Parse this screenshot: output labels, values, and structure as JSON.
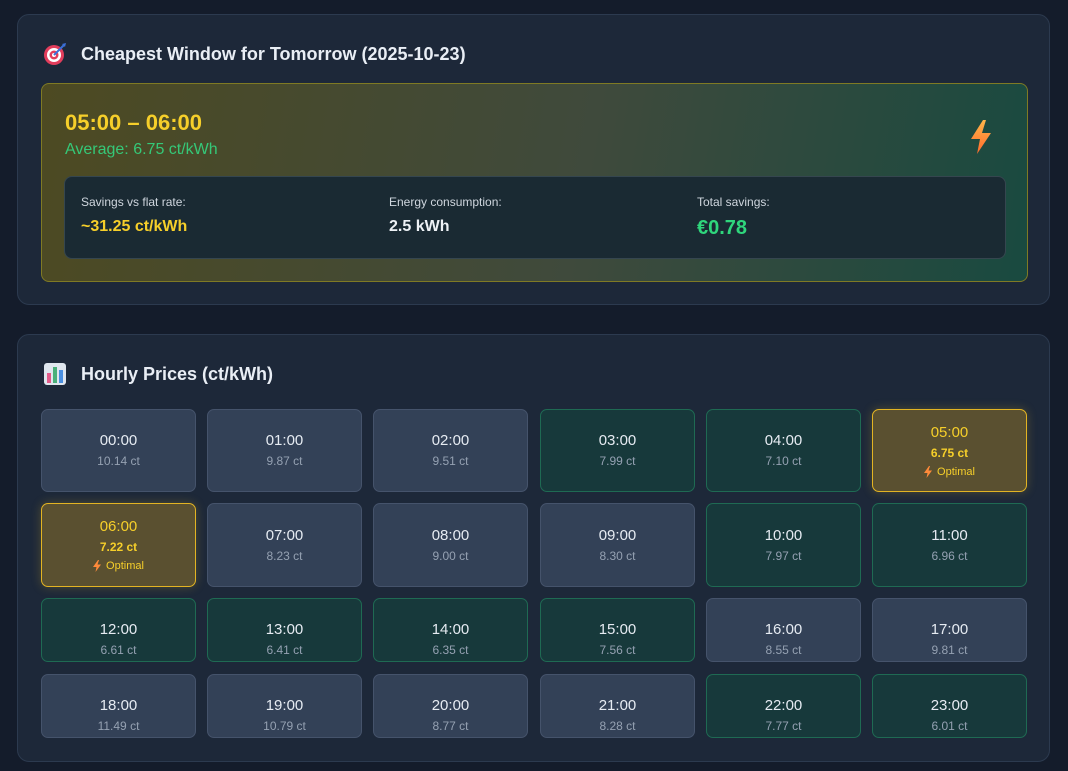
{
  "window_card": {
    "title": "Cheapest Window for Tomorrow (2025-10-23)",
    "icon": "target-icon",
    "time_range": "05:00 – 06:00",
    "average": "Average: 6.75 ct/kWh",
    "bolt_icon": "lightning-icon",
    "stats": [
      {
        "label": "Savings vs flat rate:",
        "value": "~31.25 ct/kWh"
      },
      {
        "label": "Energy consumption:",
        "value": "2.5 kWh"
      },
      {
        "label": "Total savings:",
        "value": "€0.78"
      }
    ]
  },
  "prices_card": {
    "title": "Hourly Prices (ct/kWh)",
    "icon": "bar-chart-icon",
    "optimal_label": "Optimal",
    "hours": [
      {
        "time": "00:00",
        "price": "10.14 ct",
        "state": "normal"
      },
      {
        "time": "01:00",
        "price": "9.87 ct",
        "state": "normal"
      },
      {
        "time": "02:00",
        "price": "9.51 ct",
        "state": "normal"
      },
      {
        "time": "03:00",
        "price": "7.99 ct",
        "state": "cheap"
      },
      {
        "time": "04:00",
        "price": "7.10 ct",
        "state": "cheap"
      },
      {
        "time": "05:00",
        "price": "6.75 ct",
        "state": "optimal"
      },
      {
        "time": "06:00",
        "price": "7.22 ct",
        "state": "optimal"
      },
      {
        "time": "07:00",
        "price": "8.23 ct",
        "state": "normal"
      },
      {
        "time": "08:00",
        "price": "9.00 ct",
        "state": "normal"
      },
      {
        "time": "09:00",
        "price": "8.30 ct",
        "state": "normal"
      },
      {
        "time": "10:00",
        "price": "7.97 ct",
        "state": "cheap"
      },
      {
        "time": "11:00",
        "price": "6.96 ct",
        "state": "cheap"
      },
      {
        "time": "12:00",
        "price": "6.61 ct",
        "state": "cheap"
      },
      {
        "time": "13:00",
        "price": "6.41 ct",
        "state": "cheap"
      },
      {
        "time": "14:00",
        "price": "6.35 ct",
        "state": "cheap"
      },
      {
        "time": "15:00",
        "price": "7.56 ct",
        "state": "cheap"
      },
      {
        "time": "16:00",
        "price": "8.55 ct",
        "state": "normal"
      },
      {
        "time": "17:00",
        "price": "9.81 ct",
        "state": "normal"
      },
      {
        "time": "18:00",
        "price": "11.49 ct",
        "state": "normal"
      },
      {
        "time": "19:00",
        "price": "10.79 ct",
        "state": "normal"
      },
      {
        "time": "20:00",
        "price": "8.77 ct",
        "state": "normal"
      },
      {
        "time": "21:00",
        "price": "8.28 ct",
        "state": "normal"
      },
      {
        "time": "22:00",
        "price": "7.77 ct",
        "state": "cheap"
      },
      {
        "time": "23:00",
        "price": "6.01 ct",
        "state": "cheap"
      }
    ]
  },
  "colors": {
    "optimal": "#f6cf2a",
    "cheap": "#17393b",
    "normal": "#334157",
    "savings": "#2fd67c"
  }
}
